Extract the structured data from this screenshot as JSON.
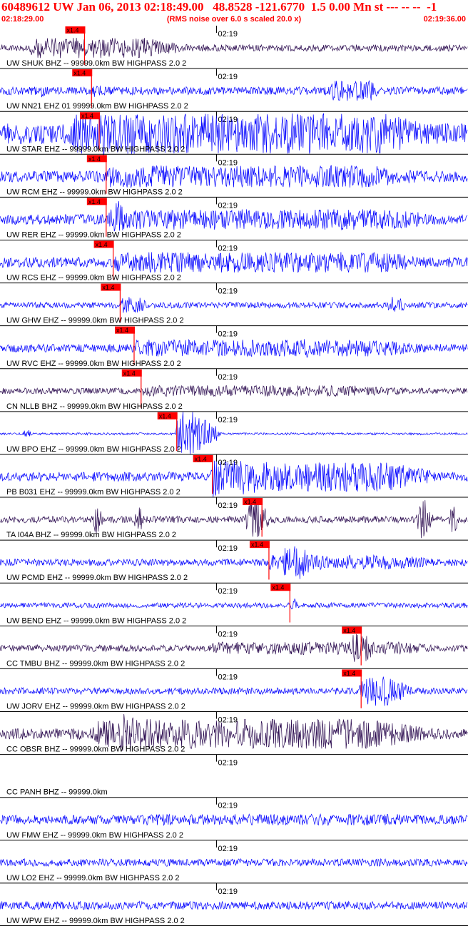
{
  "header": {
    "title": "60489612 UW Jan 06, 2013 02:18:49.00   48.8528 -121.6770  1.5 0.00 Mn st --- -- --  -1",
    "time_start": "02:18:29.00",
    "rms_note": "(RMS noise over 6.0 s scaled 20.0 x)",
    "time_end": "02:19:36.00"
  },
  "colors": {
    "header_text": "#ff0000",
    "trace_blue": "#0000ff",
    "trace_dark": "#2a0a4e",
    "pick": "#ff0000",
    "grid": "#000000"
  },
  "chart_data": {
    "type": "line",
    "title": "60489612 UW Jan 06, 2013 02:18:49.00   48.8528 -121.6770  1.5 0.00 Mn st --- -- --  -1",
    "x_start": "02:18:29.00",
    "x_end": "02:19:36.00",
    "x_range_seconds": [
      0,
      67
    ],
    "minute_tick": {
      "label": "02:19",
      "t": 31.0
    },
    "pick_label": "x1.4",
    "grid": true,
    "series": [
      {
        "name": "UW SHUK BHZ -- 99999.0km BW  HIGHPASS  2.0  2",
        "color": "dark",
        "pick_t": 12.1,
        "amp": 0.18,
        "bursts": [
          [
            4,
            30,
            0.55,
            9
          ]
        ]
      },
      {
        "name": "UW NN21 EHZ 01 99999.0km BW  HIGHPASS  2.0  2",
        "color": "blue",
        "pick_t": 13.1,
        "amp": 0.22,
        "bursts": [
          [
            5.5,
            7,
            0.5,
            1
          ],
          [
            13,
            15,
            0.5,
            1
          ],
          [
            47,
            55,
            0.55,
            2
          ]
        ]
      },
      {
        "name": "UW STAR EHZ -- 99999.0km BW  HIGHPASS  2.0  2",
        "color": "blue",
        "pick_t": 14.2,
        "amp": 0.55,
        "bursts": [
          [
            10,
            67,
            1.1,
            12
          ],
          [
            14,
            18,
            1.6,
            4
          ]
        ]
      },
      {
        "name": "UW RCM EHZ -- 99999.0km BW  HIGHPASS  2.0  2",
        "color": "blue",
        "pick_t": 15.2,
        "amp": 0.3,
        "bursts": [
          [
            15,
            67,
            0.6,
            14
          ]
        ]
      },
      {
        "name": "UW RER EHZ -- 99999.0km BW  HIGHPASS  2.0  2",
        "color": "blue",
        "pick_t": 15.2,
        "amp": 0.28,
        "bursts": [
          [
            15,
            67,
            0.55,
            10
          ],
          [
            16,
            19,
            1.1,
            2
          ]
        ]
      },
      {
        "name": "UW RCS EHZ -- 99999.0km BW  HIGHPASS  2.0  2",
        "color": "blue",
        "pick_t": 16.2,
        "amp": 0.28,
        "bursts": [
          [
            16,
            67,
            0.55,
            12
          ]
        ]
      },
      {
        "name": "UW GHW EHZ -- 99999.0km BW  HIGHPASS  2.0  2",
        "color": "blue",
        "pick_t": 17.2,
        "amp": 0.16,
        "bursts": [
          [
            17,
            22,
            0.45,
            2
          ],
          [
            55,
            59,
            0.45,
            2
          ]
        ]
      },
      {
        "name": "UW RVC EHZ -- 99999.0km BW  HIGHPASS  2.0  2",
        "color": "blue",
        "pick_t": 19.2,
        "amp": 0.22,
        "bursts": [
          [
            19,
            67,
            0.45,
            12
          ],
          [
            43,
            45,
            0.55,
            1
          ]
        ]
      },
      {
        "name": "CN NLLB BHZ -- 99999.0km BW  HIGHPASS  2.0  2",
        "color": "dark",
        "pick_t": 20.2,
        "amp": 0.16,
        "bursts": [
          [
            20,
            67,
            0.3,
            15
          ]
        ]
      },
      {
        "name": "UW BPO EHZ -- 99999.0km BW  HIGHPASS  2.0  2",
        "color": "blue",
        "pick_t": 25.3,
        "amp": 0.06,
        "bursts": [
          [
            3,
            5,
            0.25,
            1
          ],
          [
            25,
            32,
            1.2,
            3
          ]
        ]
      },
      {
        "name": "PB B031 EHZ -- 99999.0km BW  HIGHPASS  2.0  2",
        "color": "blue",
        "pick_t": 30.4,
        "amp": 0.25,
        "bursts": [
          [
            30,
            67,
            0.8,
            12
          ],
          [
            30,
            33,
            1.3,
            2
          ],
          [
            33,
            40,
            1.0,
            4
          ]
        ]
      },
      {
        "name": "TA I04A BHZ -- 99999.0km BW  HIGHPASS  2.0  2",
        "color": "dark",
        "pick_t": 37.5,
        "amp": 0.18,
        "bursts": [
          [
            13,
            15,
            0.8,
            1
          ],
          [
            19,
            21,
            0.7,
            1
          ],
          [
            35,
            39,
            1.2,
            2
          ],
          [
            59.5,
            62.5,
            1.3,
            2
          ],
          [
            64,
            66,
            0.8,
            1
          ]
        ]
      },
      {
        "name": "UW PCMD EHZ -- 99999.0km BW  HIGHPASS  2.0  2",
        "color": "blue",
        "pick_t": 38.5,
        "amp": 0.18,
        "bursts": [
          [
            38,
            67,
            0.4,
            10
          ],
          [
            40,
            46,
            0.9,
            3
          ]
        ]
      },
      {
        "name": "UW BEND EHZ -- 99999.0km BW  HIGHPASS  2.0  2",
        "color": "blue",
        "pick_t": 41.5,
        "amp": 0.14,
        "bursts": [
          [
            41.5,
            43,
            0.5,
            1
          ]
        ]
      },
      {
        "name": "CC TMBU BHZ -- 99999.0km BW  HIGHPASS  2.0  2",
        "color": "dark",
        "pick_t": 51.7,
        "amp": 0.18,
        "bursts": [
          [
            30,
            67,
            0.35,
            10
          ],
          [
            50,
            55,
            0.8,
            3
          ]
        ]
      },
      {
        "name": "UW JORV EHZ -- 99999.0km BW  HIGHPASS  2.0  2",
        "color": "blue",
        "pick_t": 51.7,
        "amp": 0.18,
        "bursts": [
          [
            51,
            60,
            0.8,
            4
          ]
        ]
      },
      {
        "name": "CC OBSR BHZ -- 99999.0km BW  HIGHPASS  2.0  2",
        "color": "dark",
        "pick_t": null,
        "amp": 0.3,
        "bursts": [
          [
            13,
            67,
            0.8,
            14
          ],
          [
            17,
            21,
            1.4,
            3
          ]
        ]
      },
      {
        "name": "CC PANH BHZ -- 99999.0km",
        "color": "none",
        "pick_t": null,
        "amp": 0,
        "bursts": []
      },
      {
        "name": "UW FMW EHZ -- 99999.0km BW  HIGHPASS  2.0  2",
        "color": "blue",
        "pick_t": null,
        "amp": 0.25,
        "bursts": [
          [
            20,
            67,
            0.3,
            10
          ]
        ]
      },
      {
        "name": "UW LO2 EHZ -- 99999.0km BW  HIGHPASS  2.0  2",
        "color": "blue",
        "pick_t": null,
        "amp": 0.2,
        "bursts": []
      },
      {
        "name": "UW WPW EHZ -- 99999.0km BW  HIGHPASS  2.0  2",
        "color": "blue",
        "pick_t": null,
        "amp": 0.22,
        "bursts": []
      }
    ]
  }
}
